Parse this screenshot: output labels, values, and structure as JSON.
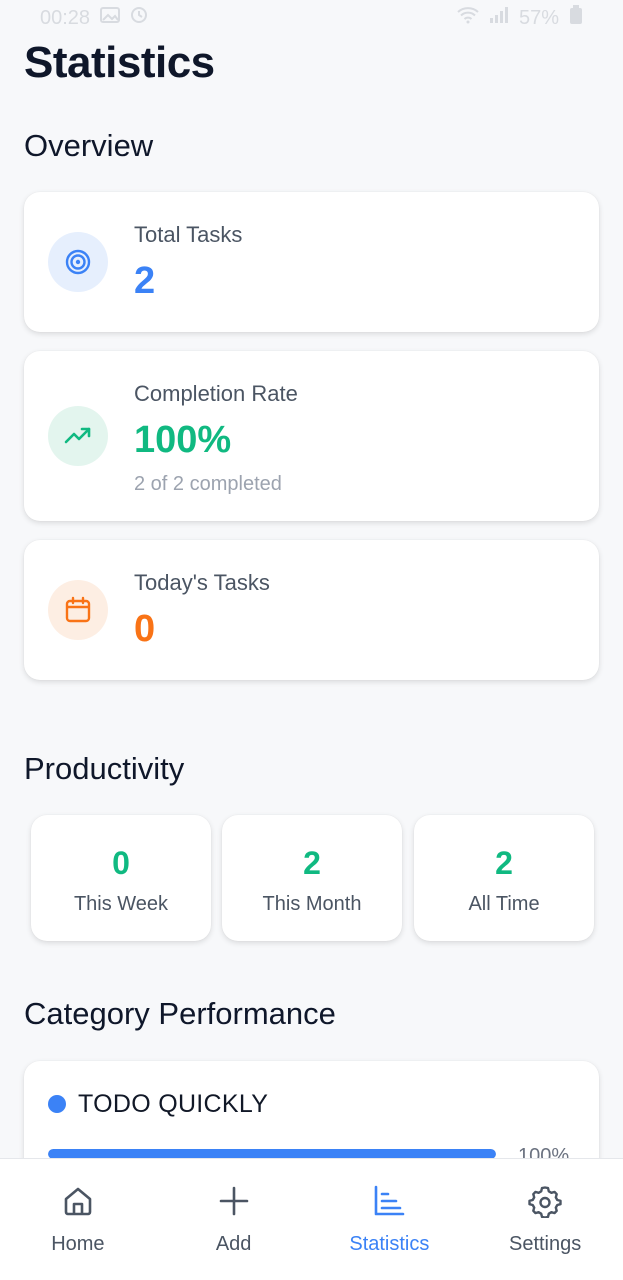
{
  "status_bar": {
    "time": "00:28",
    "battery": "57%"
  },
  "page_title": "Statistics",
  "overview": {
    "title": "Overview",
    "total_tasks": {
      "label": "Total Tasks",
      "value": "2",
      "icon": "target-icon",
      "color": "#3b82f6",
      "bg": "#e6effd"
    },
    "completion_rate": {
      "label": "Completion Rate",
      "value": "100%",
      "sub": "2 of 2 completed",
      "icon": "trending-up-icon",
      "color": "#10b981",
      "bg": "#e3f5ee"
    },
    "todays_tasks": {
      "label": "Today's Tasks",
      "value": "0",
      "icon": "calendar-icon",
      "color": "#f97316",
      "bg": "#fdeee3"
    }
  },
  "productivity": {
    "title": "Productivity",
    "items": [
      {
        "value": "0",
        "label": "This Week"
      },
      {
        "value": "2",
        "label": "This Month"
      },
      {
        "value": "2",
        "label": "All Time"
      }
    ]
  },
  "category_performance": {
    "title": "Category Performance",
    "categories": [
      {
        "name": "TODO QUICKLY",
        "percent_label": "100%",
        "progress": 1.0,
        "color": "#3b82f6"
      }
    ]
  },
  "nav": {
    "items": [
      {
        "label": "Home",
        "icon": "home-icon"
      },
      {
        "label": "Add",
        "icon": "plus-icon"
      },
      {
        "label": "Statistics",
        "icon": "bar-chart-icon",
        "active": true
      },
      {
        "label": "Settings",
        "icon": "gear-icon"
      }
    ],
    "active_color": "#3b82f6",
    "inactive_color": "#4b5563"
  }
}
